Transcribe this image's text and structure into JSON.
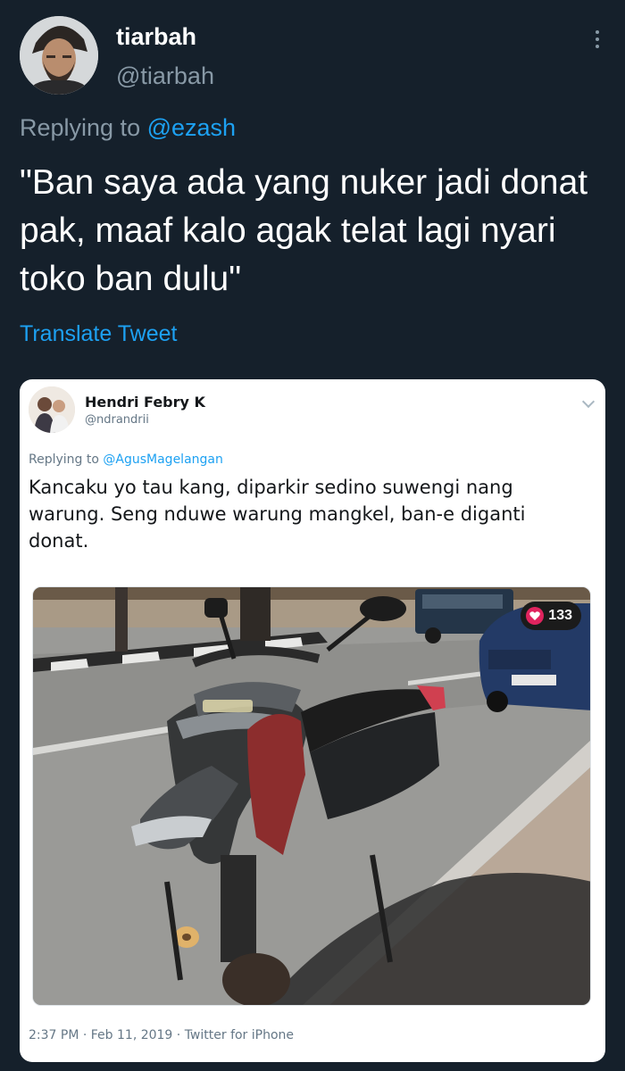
{
  "tweet": {
    "display_name": "tiarbah",
    "handle": "@tiarbah",
    "replying_prefix": "Replying to",
    "replying_mention": "@ezash",
    "text": "\"Ban saya ada yang nuker jadi donat pak, maaf kalo agak telat lagi nyari toko ban dulu\"",
    "translate_label": "Translate Tweet",
    "more_icon": "more-vertical-icon"
  },
  "quoted": {
    "display_name": "Hendri Febry K",
    "handle": "@ndrandrii",
    "replying_prefix": "Replying to",
    "replying_mention": "@AgusMagelangan",
    "text": "Kancaku yo tau kang, diparkir sedino suwengi nang warung. Seng nduwe warung mangkel, ban-e diganti donat.",
    "like_count": "133",
    "meta": "2:37 PM · Feb 11, 2019 · Twitter for iPhone",
    "photo_description_icon": "photo-motorcycle",
    "chevron_icon": "chevron-down-icon"
  },
  "colors": {
    "background": "#15202b",
    "accent": "#1da1f2",
    "secondary_text": "#8899a6",
    "heart": "#e0245e"
  }
}
